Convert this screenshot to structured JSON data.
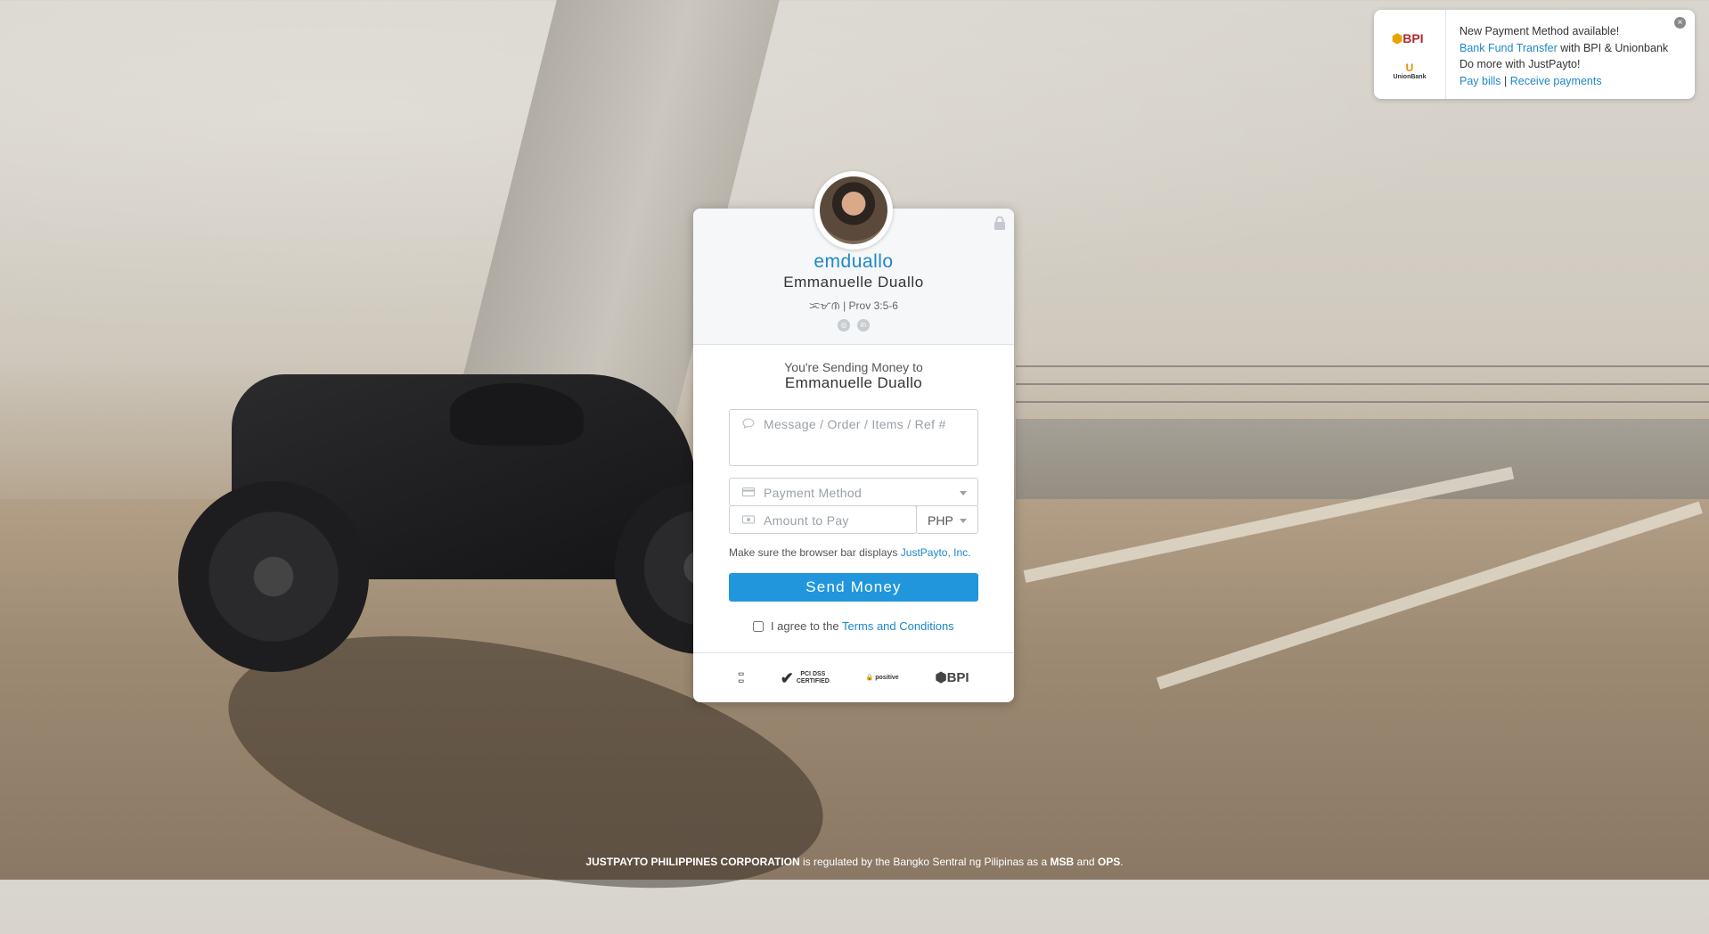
{
  "profile": {
    "username": "emduallo",
    "full_name": "Emmanuelle Duallo",
    "bio": "ᜁᜋᜈ | Prov 3:5-6",
    "socials": [
      "instagram-icon",
      "linkedin-icon"
    ]
  },
  "payment": {
    "sending_label": "You're Sending Money to",
    "recipient": "Emmanuelle Duallo",
    "message_placeholder": "Message / Order / Items / Ref #",
    "payment_method_placeholder": "Payment Method",
    "amount_placeholder": "Amount to Pay",
    "currency": "PHP",
    "notice_prefix": "Make sure the browser bar displays",
    "notice_link": "JustPayto, Inc.",
    "send_button": "Send Money",
    "agree_prefix": "I agree to the",
    "terms_link": "Terms and Conditions"
  },
  "badges": {
    "pci_line1": "PCI DSS",
    "pci_line2": "CERTIFIED",
    "positive": "positive",
    "bpi": "BPI"
  },
  "notification": {
    "bpi_logo": "BPI",
    "ub_logo": "UnionBank",
    "line1": "New Payment Method available!",
    "link1": "Bank Fund Transfer",
    "line2_suffix": " with BPI & Unionbank",
    "line3": "Do more with JustPayto!",
    "link_bills": "Pay bills",
    "separator": " | ",
    "link_receive": "Receive payments"
  },
  "footer": {
    "company": "JUSTPAYTO PHILIPPINES CORPORATION",
    "middle": " is regulated by the Bangko Sentral ng Pilipinas as a ",
    "msb": "MSB",
    "and": " and ",
    "ops": "OPS",
    "end": "."
  },
  "colors": {
    "accent": "#2196dd",
    "link": "#1e88c7"
  }
}
